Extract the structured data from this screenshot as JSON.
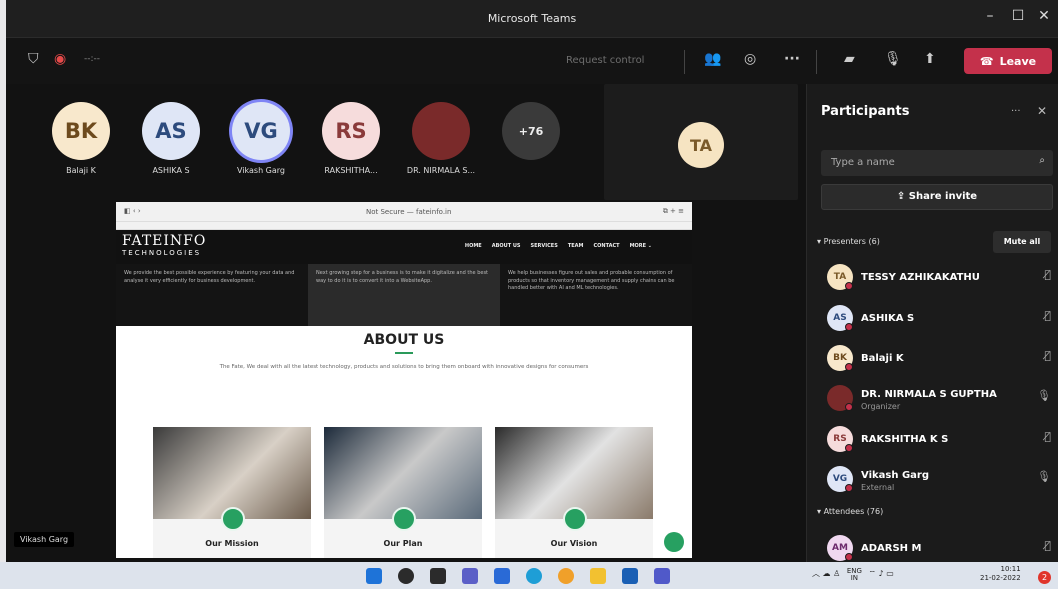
{
  "window": {
    "title": "Microsoft Teams",
    "min": "–",
    "max": "☐",
    "close": "✕"
  },
  "toolbar": {
    "request_control": "Request control",
    "more": "···",
    "leave": "Leave",
    "timer": "--:--"
  },
  "tiles": [
    {
      "initials": "BK",
      "name": "Balaji K",
      "bg": "#f8e8cc",
      "fg": "#6d4a1d"
    },
    {
      "initials": "AS",
      "name": "ASHIKA S",
      "bg": "#dfe6f6",
      "fg": "#2d4b7d"
    },
    {
      "initials": "VG",
      "name": "Vikash Garg",
      "bg": "#dfe6f6",
      "fg": "#2d4b7d"
    },
    {
      "initials": "RS",
      "name": "RAKSHITHA...",
      "bg": "#f6dcdc",
      "fg": "#8a3a3a"
    },
    {
      "initials": "",
      "name": "DR. NIRMALA S...",
      "bg": "#7a2a2a",
      "fg": "#fff"
    },
    {
      "initials": "+76",
      "name": "",
      "bg": "#3a3a3a",
      "fg": "#eee"
    }
  ],
  "ta_tile": {
    "initials": "TA"
  },
  "shared": {
    "url": "Not Secure — fateinfo.in",
    "logo": "FATEINFO",
    "logo_sub": "TECHNOLOGIES",
    "nav": [
      "HOME",
      "ABOUT US",
      "SERVICES",
      "TEAM",
      "CONTACT",
      "MORE ⌄"
    ],
    "band": [
      "We provide the best possible experience by featuring your data and analyse it very efficiently for business development.",
      "Next growing step for a business is to make it digitalize and the best way to do it is to convert it into a WebsiteApp.",
      "We help businesses figure out sales and probable consumption of products so that inventory management and supply chains can be handled better with AI and ML technologies."
    ],
    "about_title": "ABOUT US",
    "about_text": "The Fate, We deal with all the latest technology, products and solutions to bring them onboard with innovative designs for consumers",
    "cards": [
      "Our Mission",
      "Our Plan",
      "Our Vision"
    ]
  },
  "stage_label": "Vikash Garg",
  "panel": {
    "title": "Participants",
    "more": "···",
    "close": "✕",
    "search_placeholder": "Type a name",
    "share_invite": "Share invite",
    "presenters": "Presenters (6)",
    "mute_all": "Mute all",
    "attendees": "Attendees (76)",
    "people": [
      {
        "initials": "TA",
        "name": "TESSY AZHIKAKATHU",
        "sub": "",
        "bg": "#f6e4c2",
        "fg": "#7a5a2a",
        "mic": "muted"
      },
      {
        "initials": "AS",
        "name": "ASHIKA S",
        "sub": "",
        "bg": "#dfe6f6",
        "fg": "#2d4b7d",
        "mic": "muted"
      },
      {
        "initials": "BK",
        "name": "Balaji K",
        "sub": "",
        "bg": "#f8e8cc",
        "fg": "#6d4a1d",
        "mic": "muted"
      },
      {
        "initials": "",
        "name": "DR. NIRMALA S GUPTHA",
        "sub": "Organizer",
        "bg": "#7a2a2a",
        "fg": "#fff",
        "mic": "on"
      },
      {
        "initials": "RS",
        "name": "RAKSHITHA K S",
        "sub": "",
        "bg": "#f6dcdc",
        "fg": "#8a3a3a",
        "mic": "muted"
      },
      {
        "initials": "VG",
        "name": "Vikash Garg",
        "sub": "External",
        "bg": "#dfe6f6",
        "fg": "#2d4b7d",
        "mic": "on"
      },
      {
        "initials": "AM",
        "name": "ADARSH M",
        "sub": "",
        "bg": "#f0d8f0",
        "fg": "#6d2a6d",
        "mic": "muted"
      }
    ]
  },
  "taskbar": {
    "lang": "ENG",
    "lang2": "IN",
    "time": "10:11",
    "date": "21-02-2022",
    "notifications": "2"
  }
}
